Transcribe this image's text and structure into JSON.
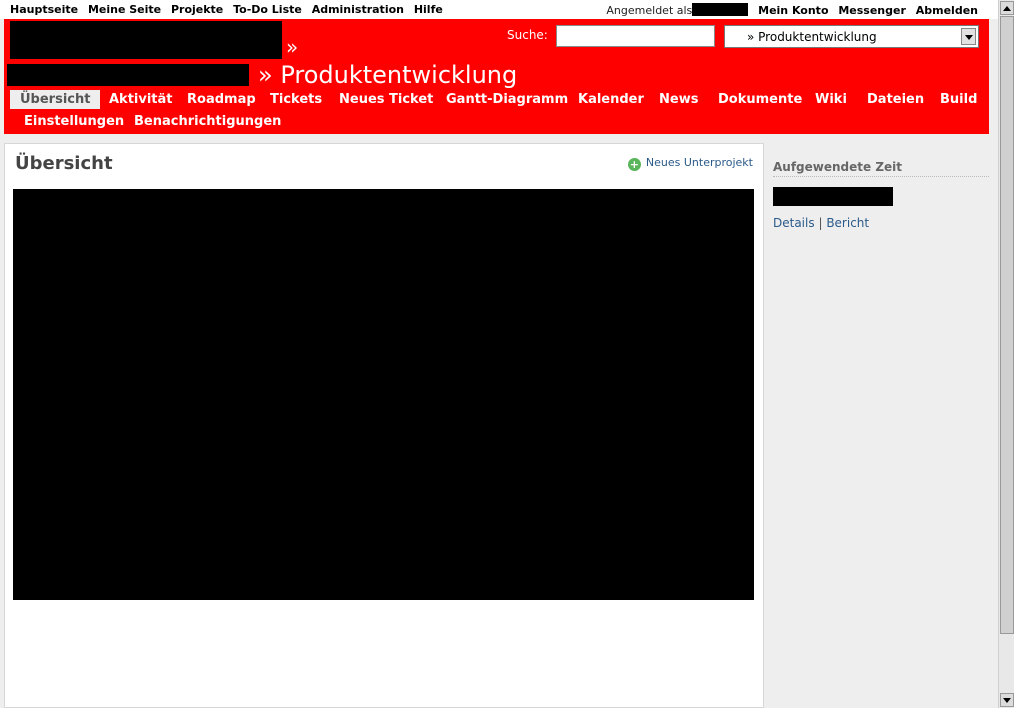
{
  "top_menu": {
    "items": [
      "Hauptseite",
      "Meine Seite",
      "Projekte",
      "To-Do Liste",
      "Administration",
      "Hilfe"
    ],
    "logged_as_label": "Angemeldet als",
    "account_items": [
      "Mein Konto",
      "Messenger",
      "Abmelden"
    ]
  },
  "header": {
    "raquo": "»",
    "title": "» Produktentwicklung",
    "search_label": "Suche:",
    "search_value": "",
    "jump_selected": "» Produktentwicklung"
  },
  "main_menu": {
    "items": [
      "Übersicht",
      "Aktivität",
      "Roadmap",
      "Tickets",
      "Neues Ticket",
      "Gantt-Diagramm",
      "Kalender",
      "News",
      "Dokumente",
      "Wiki",
      "Dateien",
      "Build",
      "Einstellungen",
      "Benachrichtigungen"
    ],
    "selected": "Übersicht"
  },
  "content": {
    "heading": "Übersicht",
    "new_subproject_label": "Neues Unterprojekt"
  },
  "sidebar": {
    "spent_time_heading": "Aufgewendete Zeit",
    "details_label": "Details",
    "separator": "|",
    "report_label": "Bericht"
  },
  "colors": {
    "header_bg": "#ff0000",
    "page_bg": "#eeeeee",
    "link": "#2a5a8a"
  }
}
